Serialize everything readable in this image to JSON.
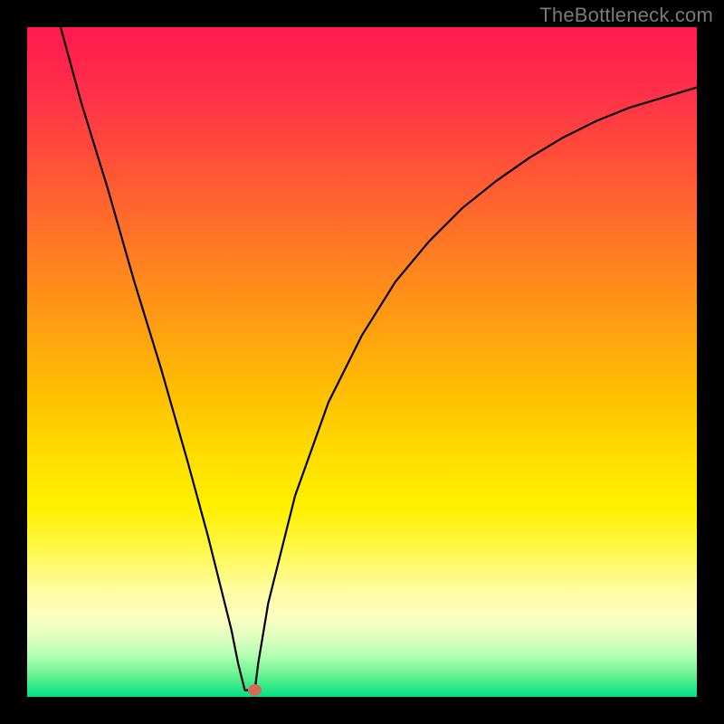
{
  "attribution": "TheBottleneck.com",
  "chart_data": {
    "type": "line",
    "title": "",
    "xlabel": "",
    "ylabel": "",
    "xlim": [
      0,
      100
    ],
    "ylim": [
      0,
      100
    ],
    "grid": false,
    "legend": false,
    "x": [
      5,
      8,
      12,
      16,
      20,
      24,
      27,
      29,
      30.5,
      31.5,
      32.5,
      34,
      34.5,
      36,
      40,
      45,
      50,
      55,
      60,
      65,
      70,
      75,
      80,
      85,
      90,
      95,
      100
    ],
    "y": [
      100,
      89,
      76,
      62,
      49,
      35,
      24,
      16,
      10,
      5,
      1,
      1,
      5,
      14,
      30,
      44,
      54,
      62,
      68,
      73,
      77,
      80.5,
      83.5,
      86,
      88,
      89.5,
      91
    ],
    "marker": {
      "x": 34,
      "y": 1,
      "color": "#d46a5a"
    }
  },
  "gradient_colors": {
    "top": "#ff1a4d",
    "mid": "#ffe000",
    "bottom": "#00e080"
  }
}
